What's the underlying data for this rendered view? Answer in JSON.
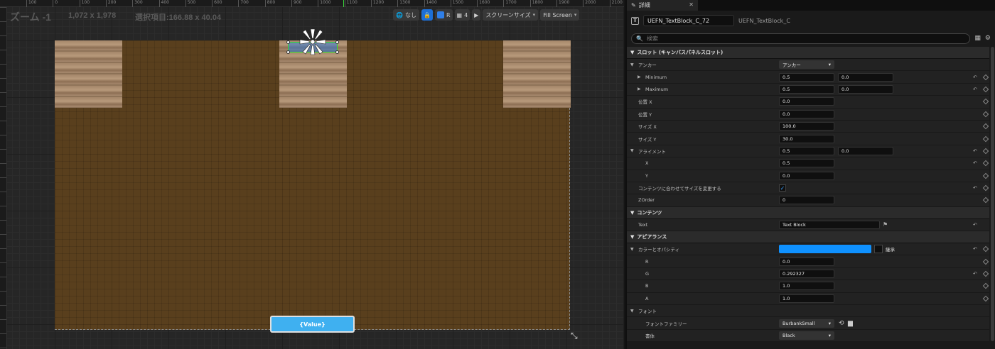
{
  "viewport": {
    "zoom": "ズーム -1",
    "resolution": "1,072 x 1,978",
    "selection": "選択項目:166.88 x 40.04",
    "ruler_labels": [
      "100",
      "0",
      "100",
      "200",
      "300",
      "400",
      "500",
      "600",
      "700",
      "800",
      "900",
      "1000",
      "1100",
      "1200",
      "1300",
      "1400",
      "1500",
      "1600",
      "1700",
      "1800",
      "1900",
      "2000",
      "2100"
    ],
    "toolbar": {
      "none_label": "なし",
      "grid_count": "4",
      "r_label": "R",
      "screen_size_label": "スクリーンサイズ",
      "fill_screen_label": "Fill Screen"
    },
    "value_button": "{Value}"
  },
  "details": {
    "tab_label": "詳細",
    "widget_name": "UEFN_TextBlock_C_72",
    "widget_class": "UEFN_TextBlock_C",
    "search_placeholder": "検索",
    "sections": {
      "slot": "スロット (キャンバスパネルスロット)",
      "content": "コンテンツ",
      "appearance": "アピアランス"
    },
    "rows": {
      "anchor": {
        "label": "アンカー",
        "value": "アンカー"
      },
      "minimum": {
        "label": "Minimum",
        "x": "0.5",
        "y": "0.0"
      },
      "maximum": {
        "label": "Maximum",
        "x": "0.5",
        "y": "0.0"
      },
      "pos_x": {
        "label": "位置 X",
        "value": "0.0"
      },
      "pos_y": {
        "label": "位置 Y",
        "value": "0.0"
      },
      "size_x": {
        "label": "サイズ X",
        "value": "100.0"
      },
      "size_y": {
        "label": "サイズ Y",
        "value": "30.0"
      },
      "alignment": {
        "label": "アライメント",
        "x": "0.5",
        "y": "0.0"
      },
      "align_x": {
        "label": "X",
        "value": "0.5"
      },
      "align_y": {
        "label": "Y",
        "value": "0.0"
      },
      "size_to_content": {
        "label": "コンテンツに合わせてサイズを変更する"
      },
      "zorder": {
        "label": "ZOrder",
        "value": "0"
      },
      "text": {
        "label": "Text",
        "value": "Text Block"
      },
      "color_opacity": {
        "label": "カラーとオパシティ",
        "inherit_label": "継承",
        "color": "#0f91ff"
      },
      "r": {
        "label": "R",
        "value": "0.0"
      },
      "g": {
        "label": "G",
        "value": "0.292327"
      },
      "b": {
        "label": "B",
        "value": "1.0"
      },
      "a": {
        "label": "A",
        "value": "1.0"
      },
      "font": {
        "label": "フォント"
      },
      "font_family": {
        "label": "フォントファミリー",
        "value": "BurbankSmall"
      },
      "typeface": {
        "label": "書体",
        "value": "Black"
      }
    }
  }
}
